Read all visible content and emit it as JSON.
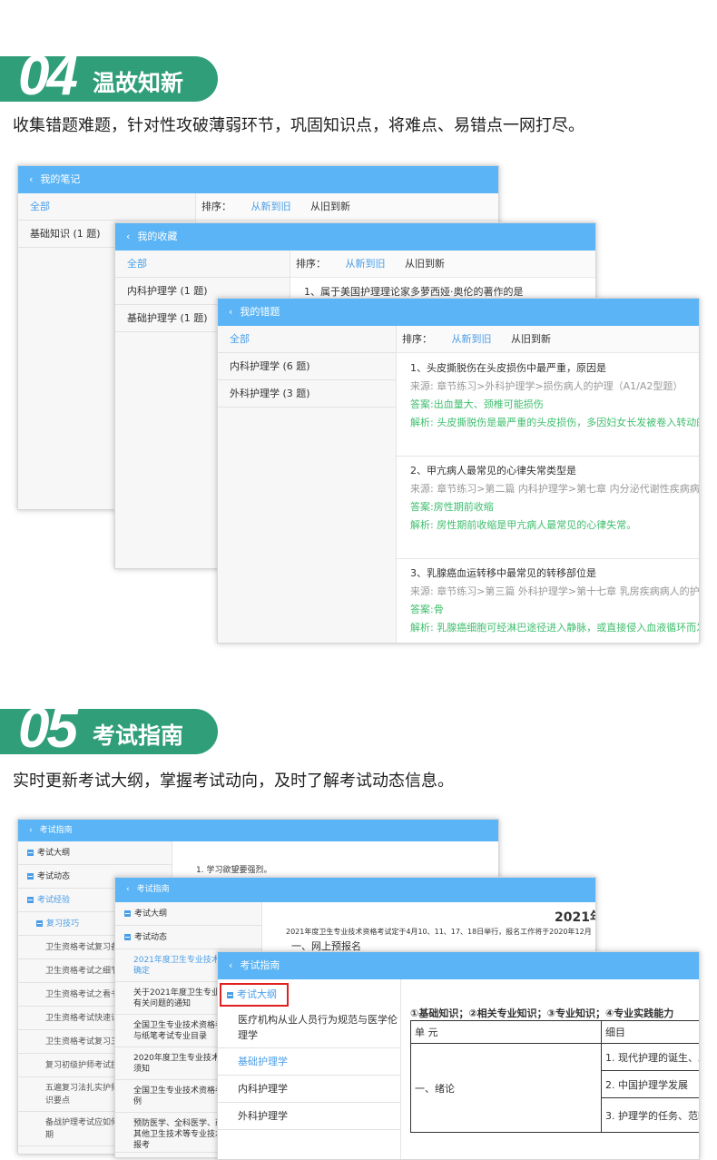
{
  "sec04": {
    "num": "04",
    "title": "温故知新",
    "desc": "收集错题难题，针对性攻破薄弱环节，巩固知识点，将难点、易错点一网打尽。"
  },
  "sec05": {
    "num": "05",
    "title": "考试指南",
    "desc": "实时更新考试大纲，掌握考试动向，及时了解考试动态信息。"
  },
  "notes": {
    "header": "我的笔记",
    "side": [
      "全部",
      "基础知识 (1 题)"
    ],
    "sort_label": "排序：",
    "sort_new": "从新到旧",
    "sort_old": "从旧到新"
  },
  "fav": {
    "header": "我的收藏",
    "side": [
      "全部",
      "内科护理学 (1 题)",
      "基础护理学 (1 题)"
    ],
    "sort_label": "排序：",
    "sort_new": "从新到旧",
    "sort_old": "从旧到新",
    "q1": "1、属于美国护理理论家多萝西娅·奥伦的著作的是"
  },
  "wrong": {
    "header": "我的错题",
    "side": [
      "全部",
      "内科护理学 (6 题)",
      "外科护理学 (3 题)"
    ],
    "sort_label": "排序：",
    "sort_new": "从新到旧",
    "sort_old": "从旧到新",
    "questions": [
      {
        "title": "1、头皮撕脱伤在头皮损伤中最严重，原因是",
        "source": "来源: 章节练习>外科护理学>损伤病人的护理（A1/A2型题）",
        "answer": "答案:出血量大、颈椎可能损伤",
        "analysis": "解析: 头皮撕脱伤是最严重的头皮损伤，多因妇女长发被卷入转动的机"
      },
      {
        "title": "2、甲亢病人最常见的心律失常类型是",
        "source": "来源: 章节练习>第二篇 内科护理学>第七章 内分泌代谢性疾病病人的护",
        "answer": "答案:房性期前收缩",
        "analysis": "解析: 房性期前收缩是甲亢病人最常见的心律失常。"
      },
      {
        "title": "3、乳腺癌血运转移中最常见的转移部位是",
        "source": "来源: 章节练习>第三篇 外科护理学>第十七章 乳房疾病病人的护理>",
        "answer": "答案:骨",
        "analysis": "解析: 乳腺癌细胞可经淋巴途径进入静脉，或直接侵入血液循环而发生"
      }
    ]
  },
  "guide1": {
    "header": "考试指南",
    "side": [
      "考试大纲",
      "考试动态",
      "考试经验",
      "复习技巧",
      "卫生资格考试复习备",
      "卫生资格考试之细节",
      "卫生资格考试之看书",
      "卫生资格考试快速记",
      "卫生资格考试复习三",
      "复习初级护师考试技",
      "五遍复习法扎实护师",
      "识要点",
      "备战护理考试应如何",
      "期"
    ],
    "content": "1. 学习欲望要强烈。"
  },
  "guide2": {
    "header": "考试指南",
    "side": [
      "考试大纲",
      "考试动态"
    ],
    "news": [
      "2021年度卫生专业技术资",
      "确定",
      "关于2021年度卫生专业技",
      "有关问题的通知",
      "全国卫生专业技术资格考",
      "与纸笔考试专业目录",
      "2020年度卫生专业技术资",
      "须知",
      "全国卫生专业技术资格考",
      "例",
      "预防医学、全科医学、药",
      "其他卫生技术等专业技术",
      "报考"
    ],
    "title": "2021年",
    "body": "2021年度卫生专业技术资格考试定于4月10、11、17、18日举行，报名工作将于2020年12月",
    "section": "一、网上预报名"
  },
  "guide3": {
    "header": "考试指南",
    "side": [
      "考试大纲",
      "医疗机构从业人员行为规范与医学伦",
      "理学",
      "基础护理学",
      "内科护理学",
      "外科护理学"
    ],
    "table_title": "①基础知识；②相关专业知识；③专业知识；④专业实践能力",
    "col1": "单 元",
    "col2": "细目",
    "unit": "一、绪论",
    "items": [
      "1. 现代护理的诞生、发",
      "2. 中国护理学发展",
      "3. 护理学的任务、范畴"
    ]
  },
  "colors": {
    "accent": "#2f9e79",
    "header_blue": "#5ab4f5",
    "link_blue": "#4a9ee8",
    "green": "#3fbf6e"
  }
}
